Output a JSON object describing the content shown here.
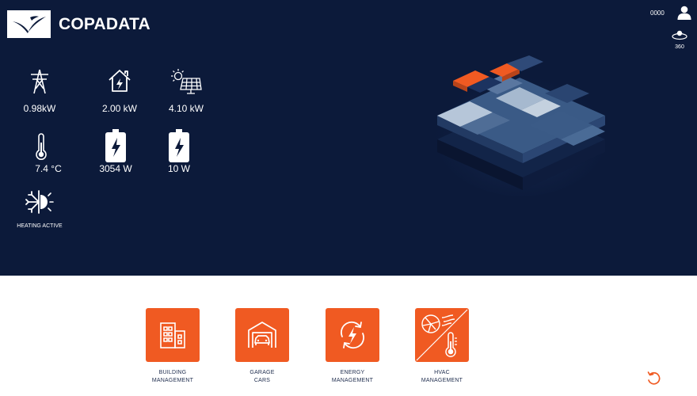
{
  "brand": {
    "name": "COPADATA"
  },
  "header": {
    "user_id": "0000",
    "view_badge": "360"
  },
  "stats": {
    "grid_power": "0.98kW",
    "house_power": "2.00 kW",
    "solar_power": "4.10 kW",
    "temperature": "7.4 °C",
    "battery1_power": "3054  W",
    "battery2_power": "10  W",
    "heating_status": "HEATING ACTIVE"
  },
  "apps": [
    {
      "label": "BUILDING\nMANAGEMENT",
      "icon": "building-icon"
    },
    {
      "label": "GARAGE\nCARS",
      "icon": "garage-car-icon"
    },
    {
      "label": "ENERGY\nMANAGEMENT",
      "icon": "energy-cycle-icon"
    },
    {
      "label": "HVAC\nMANAGEMENT",
      "icon": "hvac-icon"
    }
  ],
  "colors": {
    "accent": "#f05a22",
    "panel": "#0c1a3a",
    "text_dark": "#1f2d4e"
  }
}
